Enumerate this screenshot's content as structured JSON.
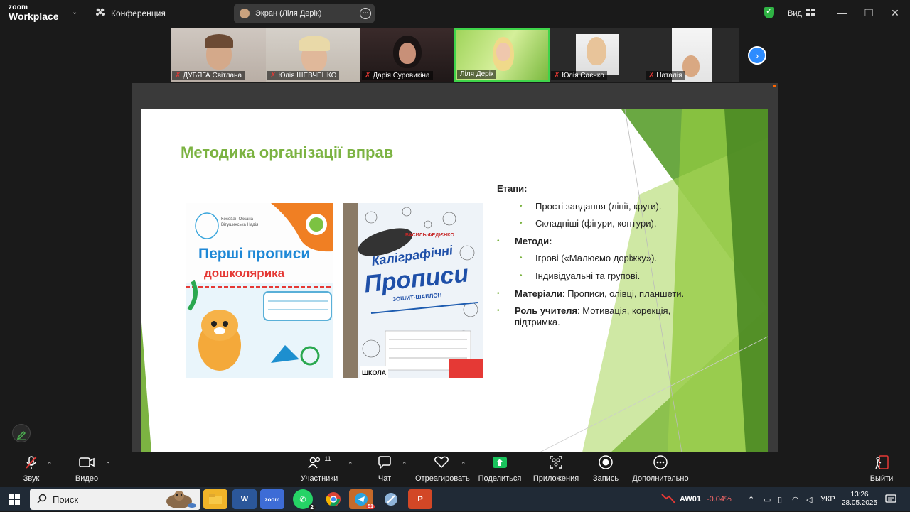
{
  "app": {
    "logo_line1": "zoom",
    "logo_line2": "Workplace",
    "meeting": "Конференция"
  },
  "screen_share_pill": "Экран (Ліля Дерік)",
  "view_label": "Вид",
  "participants": [
    {
      "name": "ДУБЯГА Світлана",
      "muted": true
    },
    {
      "name": "Юлія ШЕВЧЕНКО",
      "muted": true
    },
    {
      "name": "Дарія Суровикіна",
      "muted": true
    },
    {
      "name": "Ліля Дерік",
      "muted": false
    },
    {
      "name": "Юлія Саєнко",
      "muted": true
    },
    {
      "name": "Наталія",
      "muted": true
    }
  ],
  "slide": {
    "title": "Методика організації вправ",
    "stages_label": "Етапи:",
    "stage1": "Прості завдання (лінії, круги).",
    "stage2": "Складніші (фігури, контури).",
    "methods_label": "Методи:",
    "method1": "Ігрові («Малюємо доріжку»).",
    "method2": "Індивідуальні та групові.",
    "materials_label": "Матеріали",
    "materials_text": ": Прописи, олівці, планшети.",
    "teacher_label": "Роль учителя",
    "teacher_text": ": Мотивація, корекція, підтримка.",
    "book1": {
      "authors": "Косован Оксана\nВітушинська Надія",
      "title1": "Перші прописи",
      "title2": "дошколярика"
    },
    "book2": {
      "author": "ВАСИЛЬ ФЕДІЄНКО",
      "title1": "Каліграфічні",
      "title2": "Прописи",
      "subtitle": "ЗОШИТ-ШАБЛОН",
      "publisher": "ШКОЛА"
    }
  },
  "toolbar": {
    "audio": "Звук",
    "video": "Видео",
    "participants": "Участники",
    "participants_count": "11",
    "chat": "Чат",
    "react": "Отреагировать",
    "share": "Поделиться",
    "apps": "Приложения",
    "record": "Запись",
    "more": "Дополнительно",
    "leave": "Выйти"
  },
  "taskbar": {
    "search": "Поиск",
    "stock_name": "AW01",
    "stock_change": "-0.04%",
    "lang": "УКР",
    "time": "13:26",
    "date": "28.05.2025",
    "whatsapp_badge": "2",
    "telegram_badge": "51"
  },
  "colors": {
    "accent_green": "#7cb342",
    "zoom_blue": "#2d8cff",
    "muted_red": "#e53935"
  }
}
